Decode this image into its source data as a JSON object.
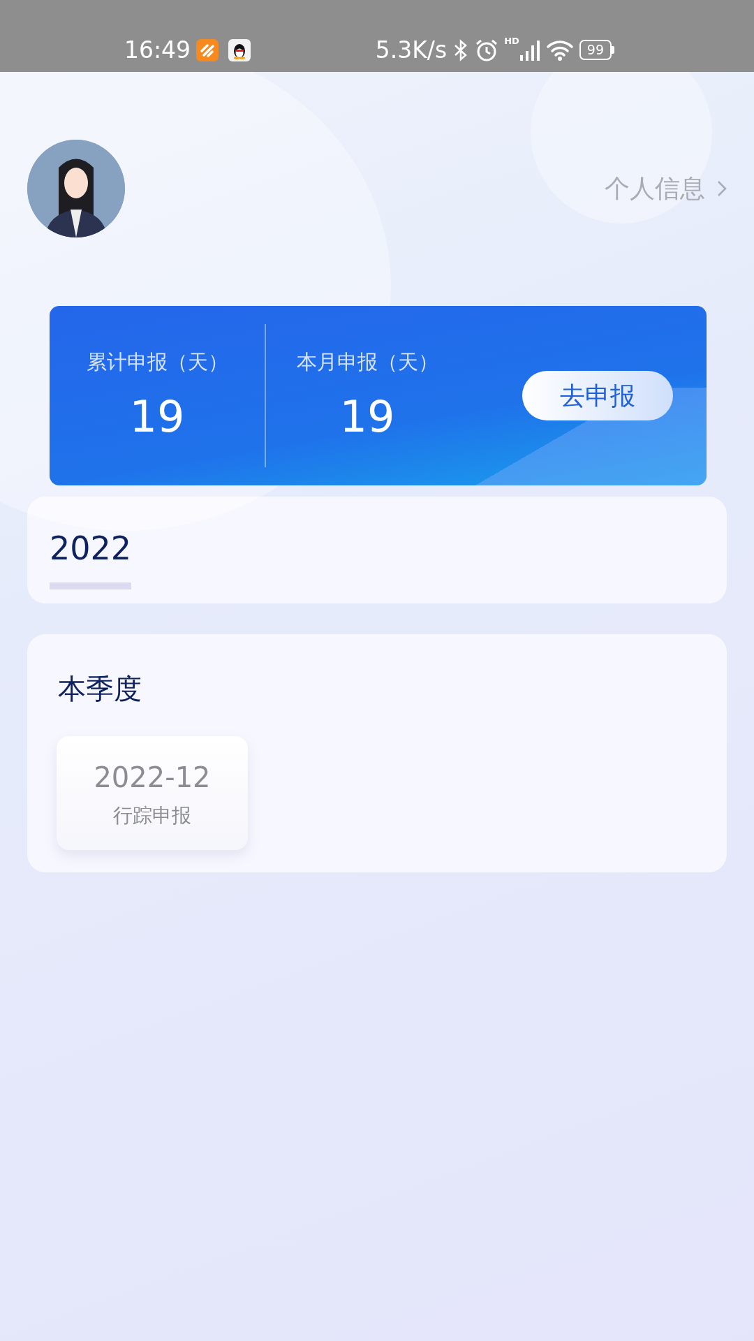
{
  "status_bar": {
    "time": "16:49",
    "net_speed": "5.3K/s",
    "signal_label": "HD",
    "battery": "99"
  },
  "header": {
    "profile_link": "个人信息"
  },
  "summary": {
    "stats": [
      {
        "label": "累计申报（天）",
        "value": "19"
      },
      {
        "label": "本月申报（天）",
        "value": "19"
      }
    ],
    "action": "去申报"
  },
  "years": [
    {
      "label": "2022",
      "selected": true
    }
  ],
  "quarter": {
    "title": "本季度",
    "items": [
      {
        "month": "2022-12",
        "type": "行踪申报"
      }
    ]
  }
}
